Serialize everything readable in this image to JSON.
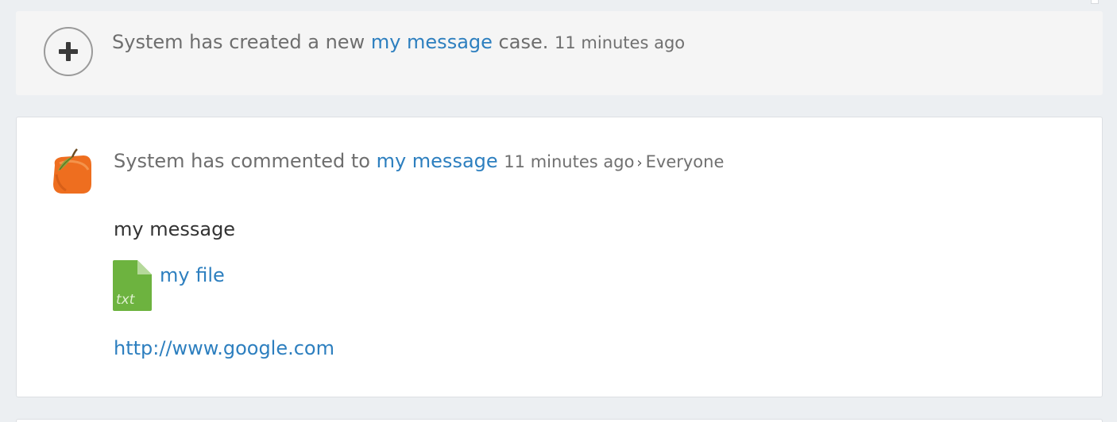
{
  "created_event": {
    "actor": "System",
    "verb": "has created a new",
    "target_link": "my message",
    "suffix": "case.",
    "time": "11 minutes ago",
    "icon": "plus-circle-icon"
  },
  "comment_event": {
    "actor": "System",
    "verb": "has commented to",
    "target_link": "my message",
    "time": "11 minutes ago",
    "separator_icon": "chevron-right-icon",
    "audience": "Everyone",
    "avatar": "orange-fruit-avatar",
    "message": "my message",
    "attachment": {
      "file_type": "txt",
      "file_name": "my file",
      "icon_color": "#6db33f"
    },
    "url": "http://www.google.com"
  },
  "colors": {
    "link": "#2d7fbf",
    "muted_text": "#6e6e6e",
    "body_text": "#333333",
    "page_bg": "#eceff2",
    "card_muted_bg": "#f5f5f5"
  }
}
